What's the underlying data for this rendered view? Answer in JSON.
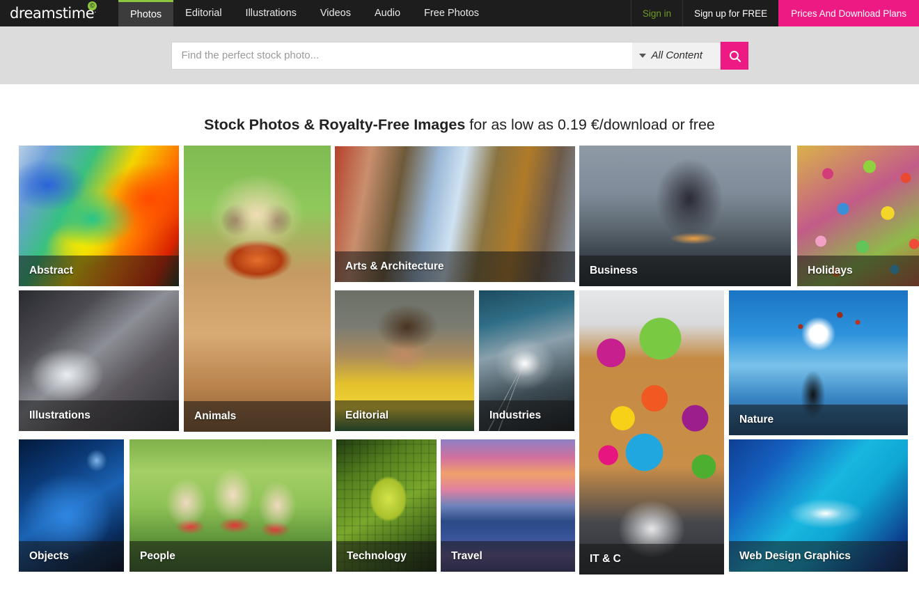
{
  "brand": {
    "name": "dreamstime",
    "registered": ".",
    "badge": "©"
  },
  "topnav": {
    "items": [
      {
        "label": "Photos",
        "active": true
      },
      {
        "label": "Editorial",
        "active": false
      },
      {
        "label": "Illustrations",
        "active": false
      },
      {
        "label": "Videos",
        "active": false
      },
      {
        "label": "Audio",
        "active": false
      },
      {
        "label": "Free Photos",
        "active": false
      }
    ],
    "sign_in": "Sign in",
    "sign_up": "Sign up for FREE",
    "plans": "Prices And Download Plans",
    "accent_pink": "#ec1a82",
    "accent_green": "#8cc63e",
    "bar_bg": "#1d1d1d"
  },
  "search": {
    "placeholder": "Find the perfect stock photo...",
    "value": "",
    "filter_selected": "All Content",
    "chevron_icon": "chevron-down-icon",
    "button_icon": "search-icon"
  },
  "heading": {
    "bold": "Stock Photos & Royalty-Free Images",
    "rest": " for as low as 0.19 €/download or free"
  },
  "categories": [
    {
      "key": "abstract",
      "label": "Abstract"
    },
    {
      "key": "animals",
      "label": "Animals"
    },
    {
      "key": "arts",
      "label": "Arts & Architecture"
    },
    {
      "key": "business",
      "label": "Business"
    },
    {
      "key": "holidays",
      "label": "Holidays"
    },
    {
      "key": "illustrations",
      "label": "Illustrations"
    },
    {
      "key": "editorial",
      "label": "Editorial"
    },
    {
      "key": "industries",
      "label": "Industries"
    },
    {
      "key": "itc",
      "label": "IT & C"
    },
    {
      "key": "nature",
      "label": "Nature"
    },
    {
      "key": "objects",
      "label": "Objects"
    },
    {
      "key": "people",
      "label": "People"
    },
    {
      "key": "technology",
      "label": "Technology"
    },
    {
      "key": "travel",
      "label": "Travel"
    },
    {
      "key": "webdesign",
      "label": "Web Design Graphics"
    }
  ]
}
